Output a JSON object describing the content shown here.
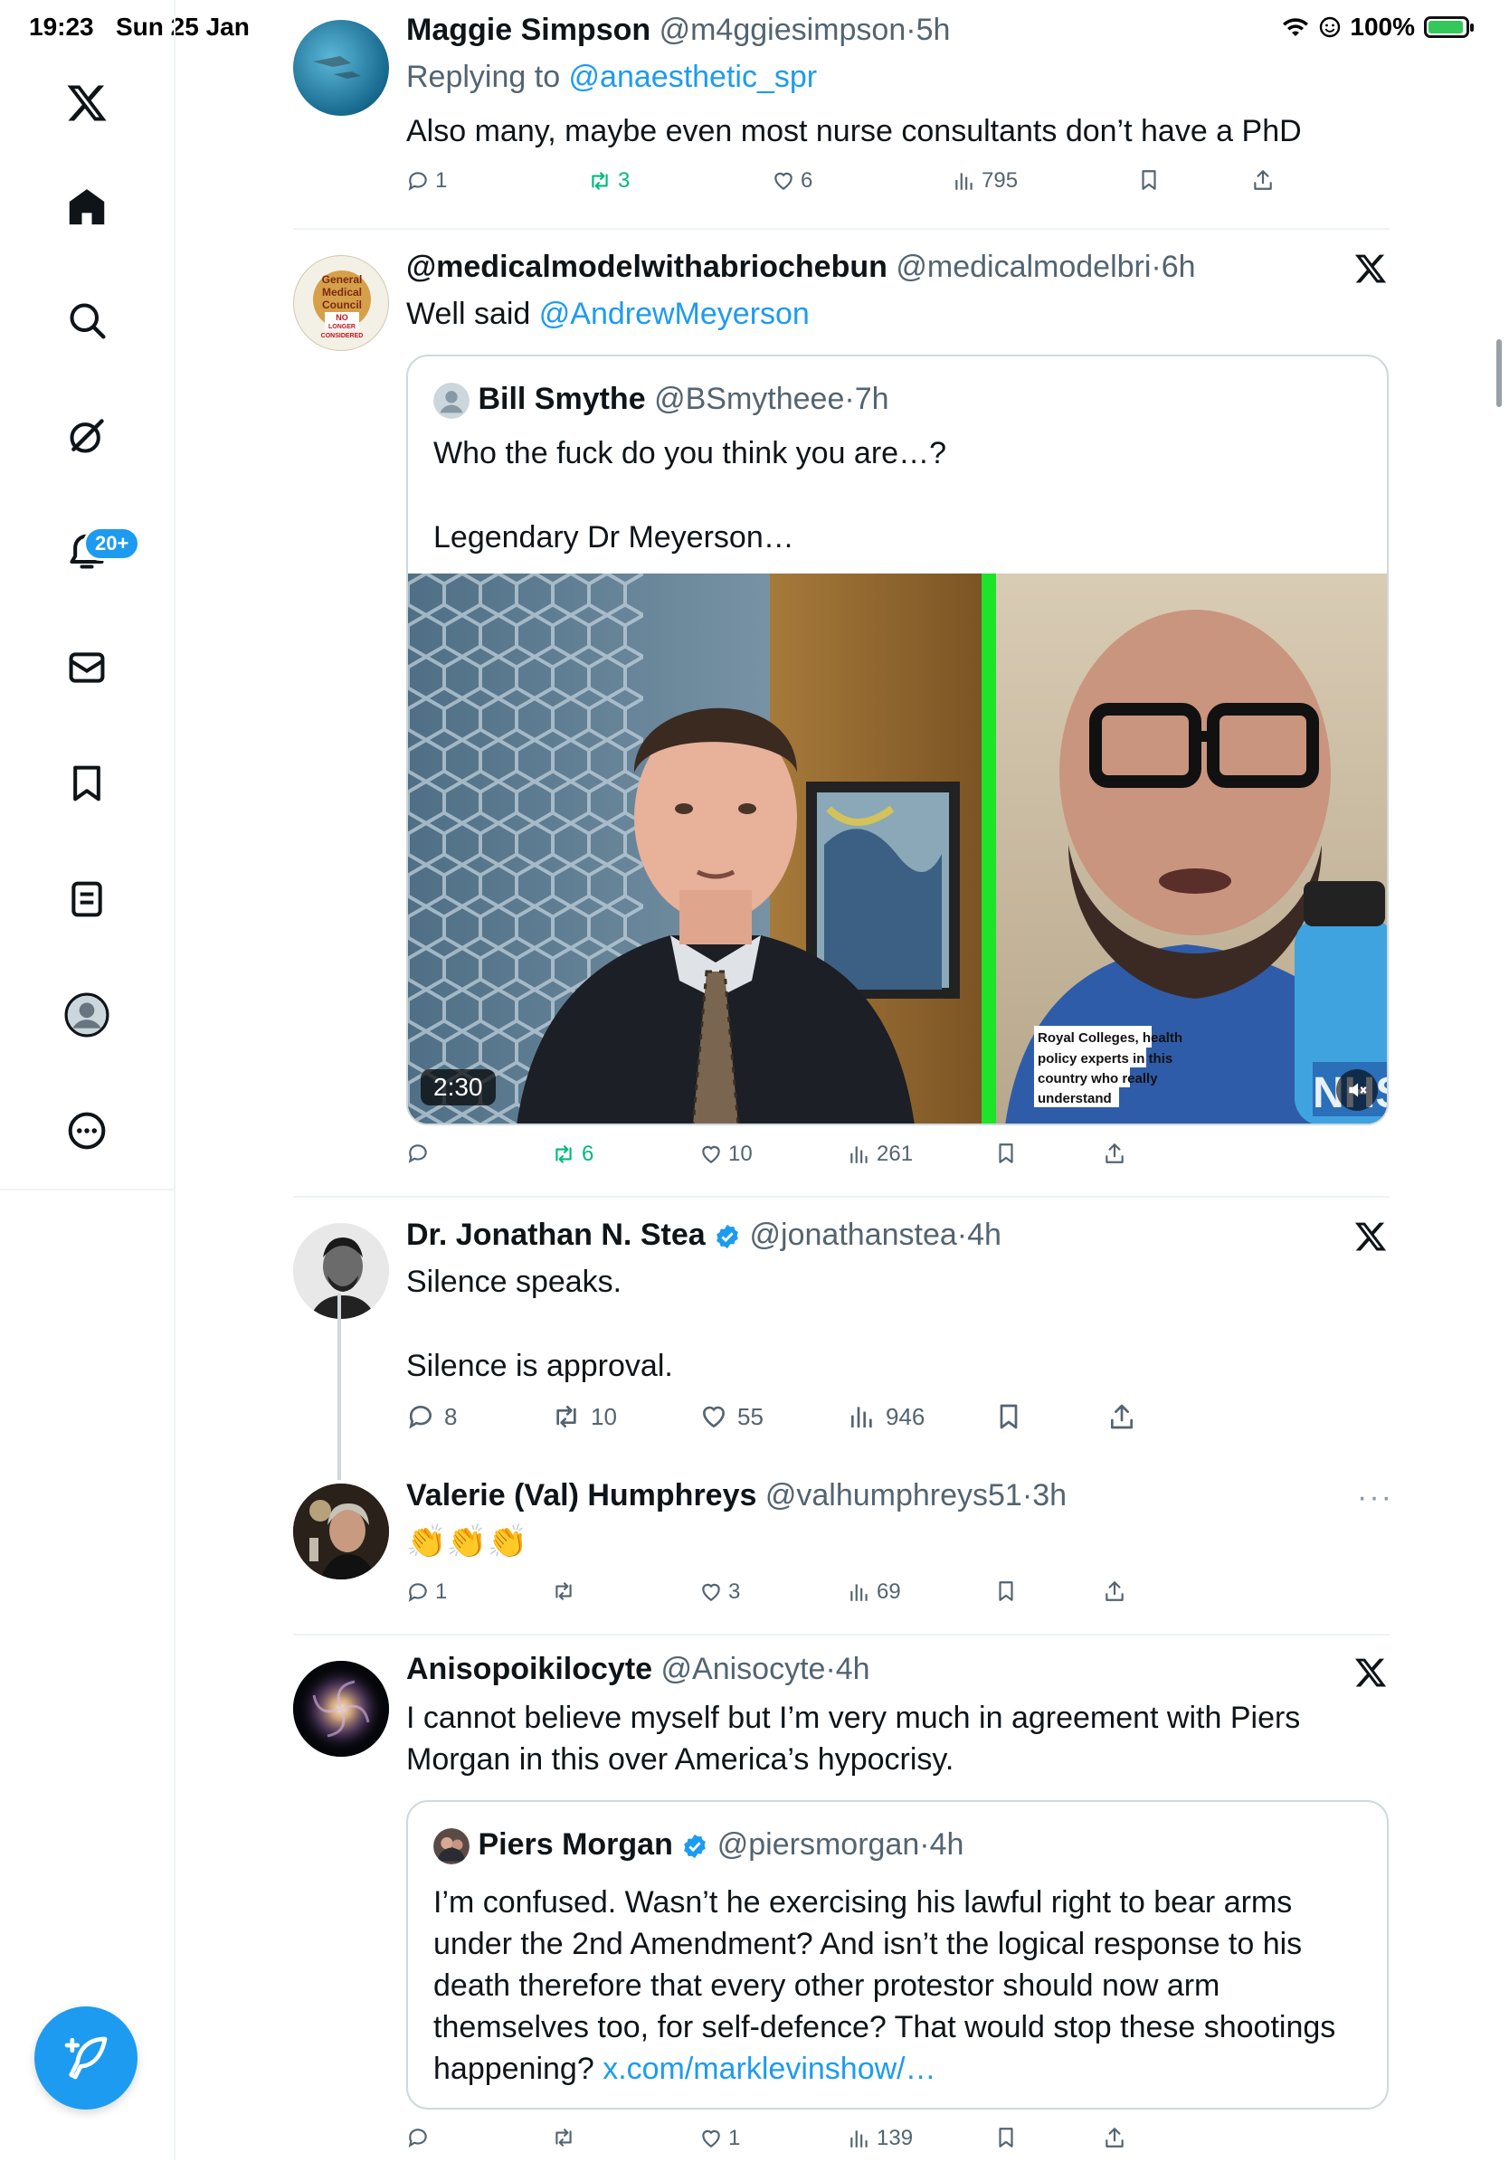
{
  "status_bar": {
    "time": "19:23",
    "date": "Sun 25 Jan",
    "battery": "100%"
  },
  "sidebar": {
    "notifications_badge": "20+"
  },
  "tweets": [
    {
      "name": "Maggie Simpson",
      "handle": "@m4ggiesimpson",
      "time": "5h",
      "replying_prefix": "Replying to ",
      "replying_to": "@anaesthetic_spr",
      "text": "Also many, maybe even most nurse consultants don’t have a PhD",
      "replies": "1",
      "reposts": "3",
      "likes": "6",
      "views": "795"
    },
    {
      "name": "@medicalmodelwithabriochebun",
      "handle": "@medicalmodelbri",
      "time": "6h",
      "text_prefix": "Well said ",
      "mention": "@AndrewMeyerson",
      "quote": {
        "name": "Bill Smythe",
        "handle": "@BSmytheee",
        "time": "7h",
        "line1": "Who the fuck do you think you are…?",
        "line2": "Legendary Dr Meyerson…",
        "video_duration": "2:30",
        "caption": [
          "Royal Colleges, health",
          "policy experts in this",
          "country who really",
          "understand"
        ],
        "nhs_text": "NHS",
        "avatar_text": [
          "General",
          "Medical",
          "Council",
          "NO",
          "LONGER",
          "CONSIDERED"
        ]
      },
      "replies": "",
      "reposts": "6",
      "likes": "10",
      "views": "261"
    },
    {
      "name": "Dr. Jonathan N. Stea",
      "handle": "@jonathanstea",
      "time": "4h",
      "line1": "Silence speaks.",
      "line2": "Silence is approval.",
      "replies": "8",
      "reposts": "10",
      "likes": "55",
      "views": "946"
    },
    {
      "name": "Valerie (Val) Humphreys",
      "handle": "@valhumphreys51",
      "time": "3h",
      "text": "👏👏👏",
      "replies": "1",
      "reposts": "",
      "likes": "3",
      "views": "69"
    },
    {
      "name": "Anisopoikilocyte",
      "handle": "@Anisocyte",
      "time": "4h",
      "line1": "I cannot believe myself but I’m very much in agreement with Piers",
      "line2": "Morgan in this over America’s hypocrisy.",
      "quote": {
        "name": "Piers Morgan",
        "handle": "@piersmorgan",
        "time": "4h",
        "lines": [
          "I’m confused. Wasn’t he exercising his lawful right to bear arms",
          "under the 2nd Amendment? And isn’t the logical response to his",
          "death therefore that every other protestor should now arm",
          "themselves too, for self-defence? That would stop these shootings"
        ],
        "last_prefix": "happening? ",
        "link": "x.com/marklevinshow/…"
      },
      "replies": "",
      "reposts": "",
      "likes": "1",
      "views": "139"
    }
  ],
  "colors": {
    "accent": "#1d9bf0",
    "repost": "#00ba7c",
    "secondary": "#536471",
    "divider": "#eff3f4"
  }
}
